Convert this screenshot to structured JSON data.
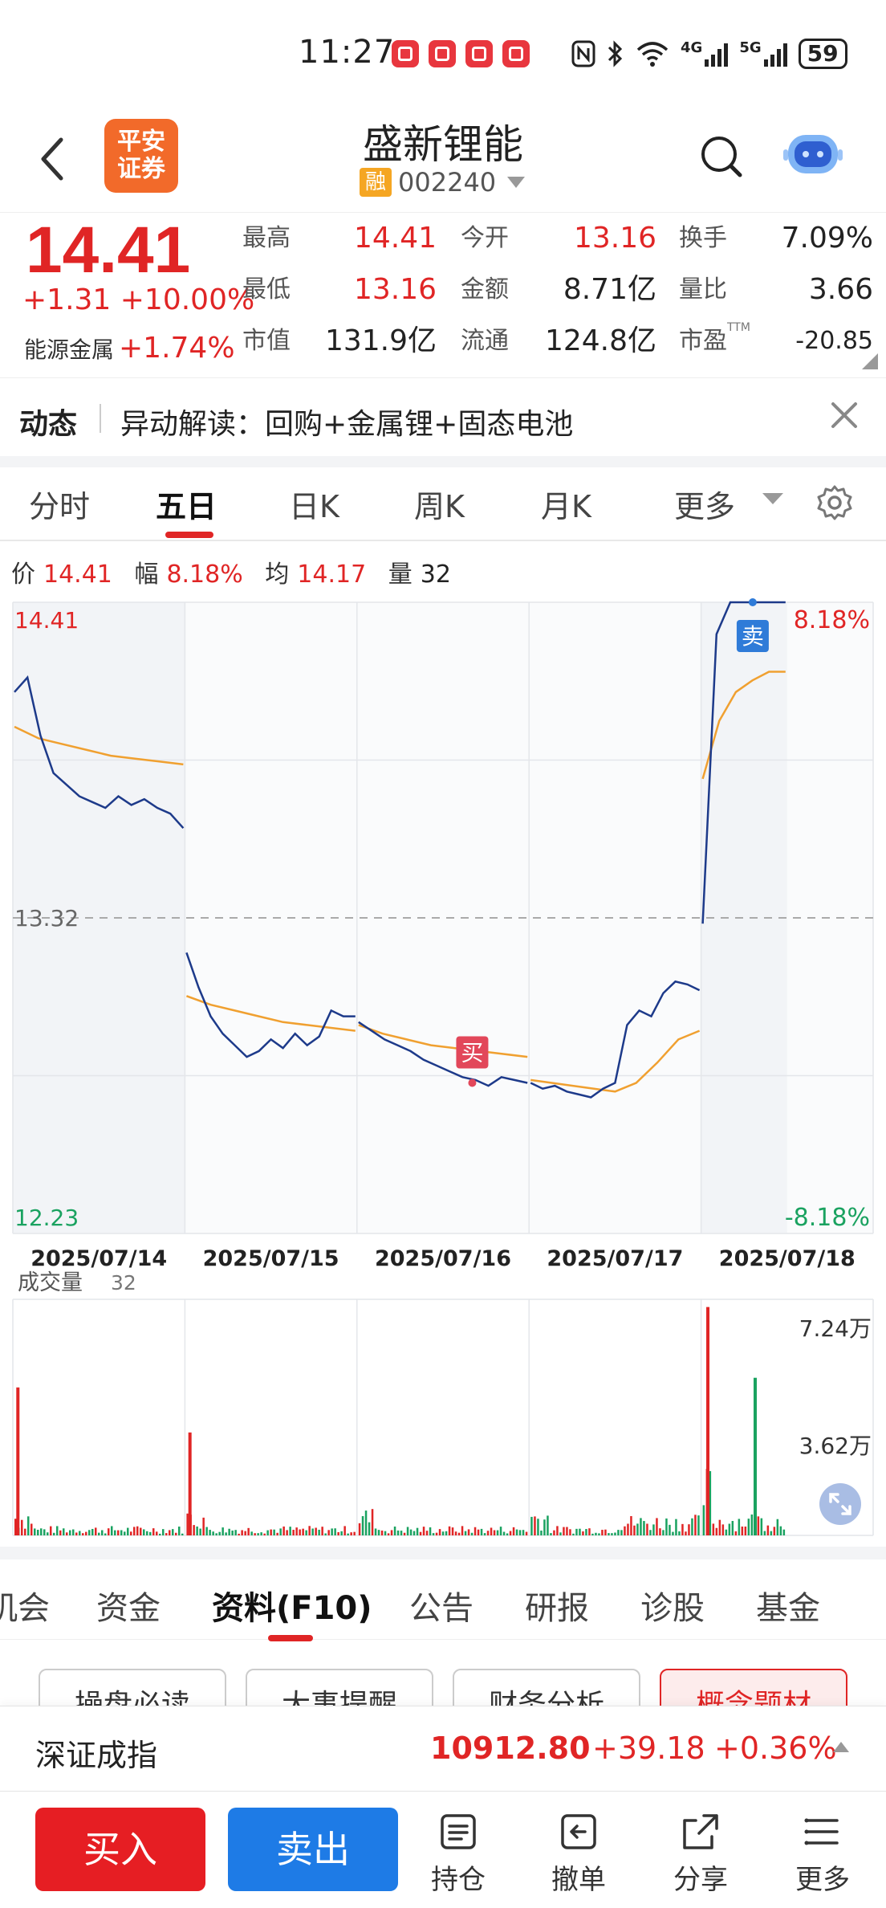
{
  "status_bar": {
    "time": "11:27",
    "battery": "59",
    "net": "4G",
    "net2": "5G"
  },
  "header": {
    "logo_line1": "平安",
    "logo_line2": "证券",
    "stock_name": "盛新锂能",
    "rong": "融",
    "code": "002240"
  },
  "quote": {
    "price": "14.41",
    "change": "+1.31 +10.00%",
    "sector_name": "能源金属",
    "sector_change": "+1.74%",
    "rows": [
      [
        {
          "label": "最高",
          "value": "14.41"
        },
        {
          "label": "今开",
          "value": "13.16"
        },
        {
          "label": "换手",
          "value": "7.09%"
        }
      ],
      [
        {
          "label": "最低",
          "value": "13.16"
        },
        {
          "label": "金额",
          "value": "8.71亿"
        },
        {
          "label": "量比",
          "value": "3.66"
        }
      ],
      [
        {
          "label": "市值",
          "value": "131.9亿"
        },
        {
          "label": "流通",
          "value": "124.8亿"
        },
        {
          "label": "市盈",
          "value": "-20.85"
        }
      ]
    ],
    "ttm": "TTM"
  },
  "news": {
    "tag": "动态",
    "text": "异动解读：回购+金属锂+固态电池"
  },
  "kline_tabs": [
    "分时",
    "五日",
    "日K",
    "周K",
    "月K",
    "更多"
  ],
  "active_kline_tab": "五日",
  "info": {
    "price_label": "价",
    "price": "14.41",
    "amp_label": "幅",
    "amp": "8.18%",
    "avg_label": "均",
    "avg": "14.17",
    "vol_label": "量",
    "vol": "32"
  },
  "chart_data": {
    "type": "line",
    "title": "",
    "x": [
      "2025/07/14",
      "2025/07/15",
      "2025/07/16",
      "2025/07/17",
      "2025/07/18"
    ],
    "ylim": [
      12.23,
      14.41
    ],
    "y_left_ticks": [
      "14.41",
      "13.32",
      "12.23"
    ],
    "y_right_ticks": [
      "8.18%",
      "-8.18%"
    ],
    "prev_close": 13.32,
    "series": [
      {
        "day": "2025/07/14",
        "price": [
          14.1,
          14.15,
          13.95,
          13.82,
          13.78,
          13.74,
          13.72,
          13.7,
          13.74,
          13.71,
          13.73,
          13.7,
          13.68,
          13.63
        ],
        "avg": [
          13.98,
          13.94,
          13.92,
          13.9,
          13.88,
          13.87,
          13.86,
          13.85
        ]
      },
      {
        "day": "2025/07/15",
        "price": [
          13.2,
          13.08,
          12.98,
          12.92,
          12.88,
          12.84,
          12.86,
          12.9,
          12.87,
          12.92,
          12.88,
          12.91,
          13.0,
          12.98,
          12.98
        ],
        "avg": [
          13.05,
          13.02,
          13.0,
          12.98,
          12.96,
          12.95,
          12.94,
          12.93
        ]
      },
      {
        "day": "2025/07/16",
        "price": [
          12.96,
          12.93,
          12.9,
          12.88,
          12.86,
          12.83,
          12.81,
          12.79,
          12.77,
          12.76,
          12.74,
          12.77,
          12.76,
          12.75
        ],
        "avg": [
          12.95,
          12.92,
          12.9,
          12.88,
          12.87,
          12.86,
          12.85,
          12.84
        ]
      },
      {
        "day": "2025/07/17",
        "price": [
          12.75,
          12.73,
          12.74,
          12.72,
          12.71,
          12.7,
          12.73,
          12.75,
          12.95,
          13.0,
          12.98,
          13.06,
          13.1,
          13.09,
          13.07
        ],
        "avg": [
          12.76,
          12.75,
          12.74,
          12.73,
          12.72,
          12.75,
          12.82,
          12.9,
          12.93
        ]
      },
      {
        "day": "2025/07/18",
        "price": [
          13.3,
          14.3,
          14.41,
          14.41,
          14.41,
          14.41,
          14.41
        ],
        "avg": [
          13.8,
          14.0,
          14.1,
          14.14,
          14.17,
          14.17
        ]
      }
    ],
    "markers": [
      {
        "text": "买",
        "day": "2025/07/16",
        "price": 12.75
      },
      {
        "text": "卖",
        "day": "2025/07/18",
        "price": 14.41
      }
    ],
    "volume": {
      "label": "成交量",
      "value": "32",
      "ticks": [
        "7.24万",
        "3.62万"
      ],
      "ymax_wan": 7.24,
      "peaks": [
        {
          "day": "2025/07/14",
          "at": 0.02,
          "wan": 4.6,
          "color": "red"
        },
        {
          "day": "2025/07/15",
          "at": 0.02,
          "wan": 3.2,
          "color": "red"
        },
        {
          "day": "2025/07/18",
          "at": 0.06,
          "wan": 7.1,
          "color": "red"
        },
        {
          "day": "2025/07/18",
          "at": 0.61,
          "wan": 4.9,
          "color": "green"
        }
      ]
    }
  },
  "f10_tabs": [
    "机会",
    "资金",
    "资料(F10)",
    "公告",
    "研报",
    "诊股",
    "基金"
  ],
  "active_f10_tab": "资料(F10)",
  "chips": [
    "操盘必读",
    "大事提醒",
    "财务分析",
    "概念题材"
  ],
  "index_ticker": {
    "name": "深证成指",
    "value": "10912.80",
    "change": "+39.18",
    "pct": "+0.36%"
  },
  "bottom_nav": {
    "buy": "买入",
    "sell": "卖出",
    "hold": "持仓",
    "cancel": "撤单",
    "share": "分享",
    "more": "更多"
  },
  "colors": {
    "up": "#e02525",
    "down": "#1aa260",
    "price_line": "#1d3a8a",
    "avg_line": "#f0a030",
    "buy": "#e61e23",
    "sell": "#1e7be6"
  }
}
